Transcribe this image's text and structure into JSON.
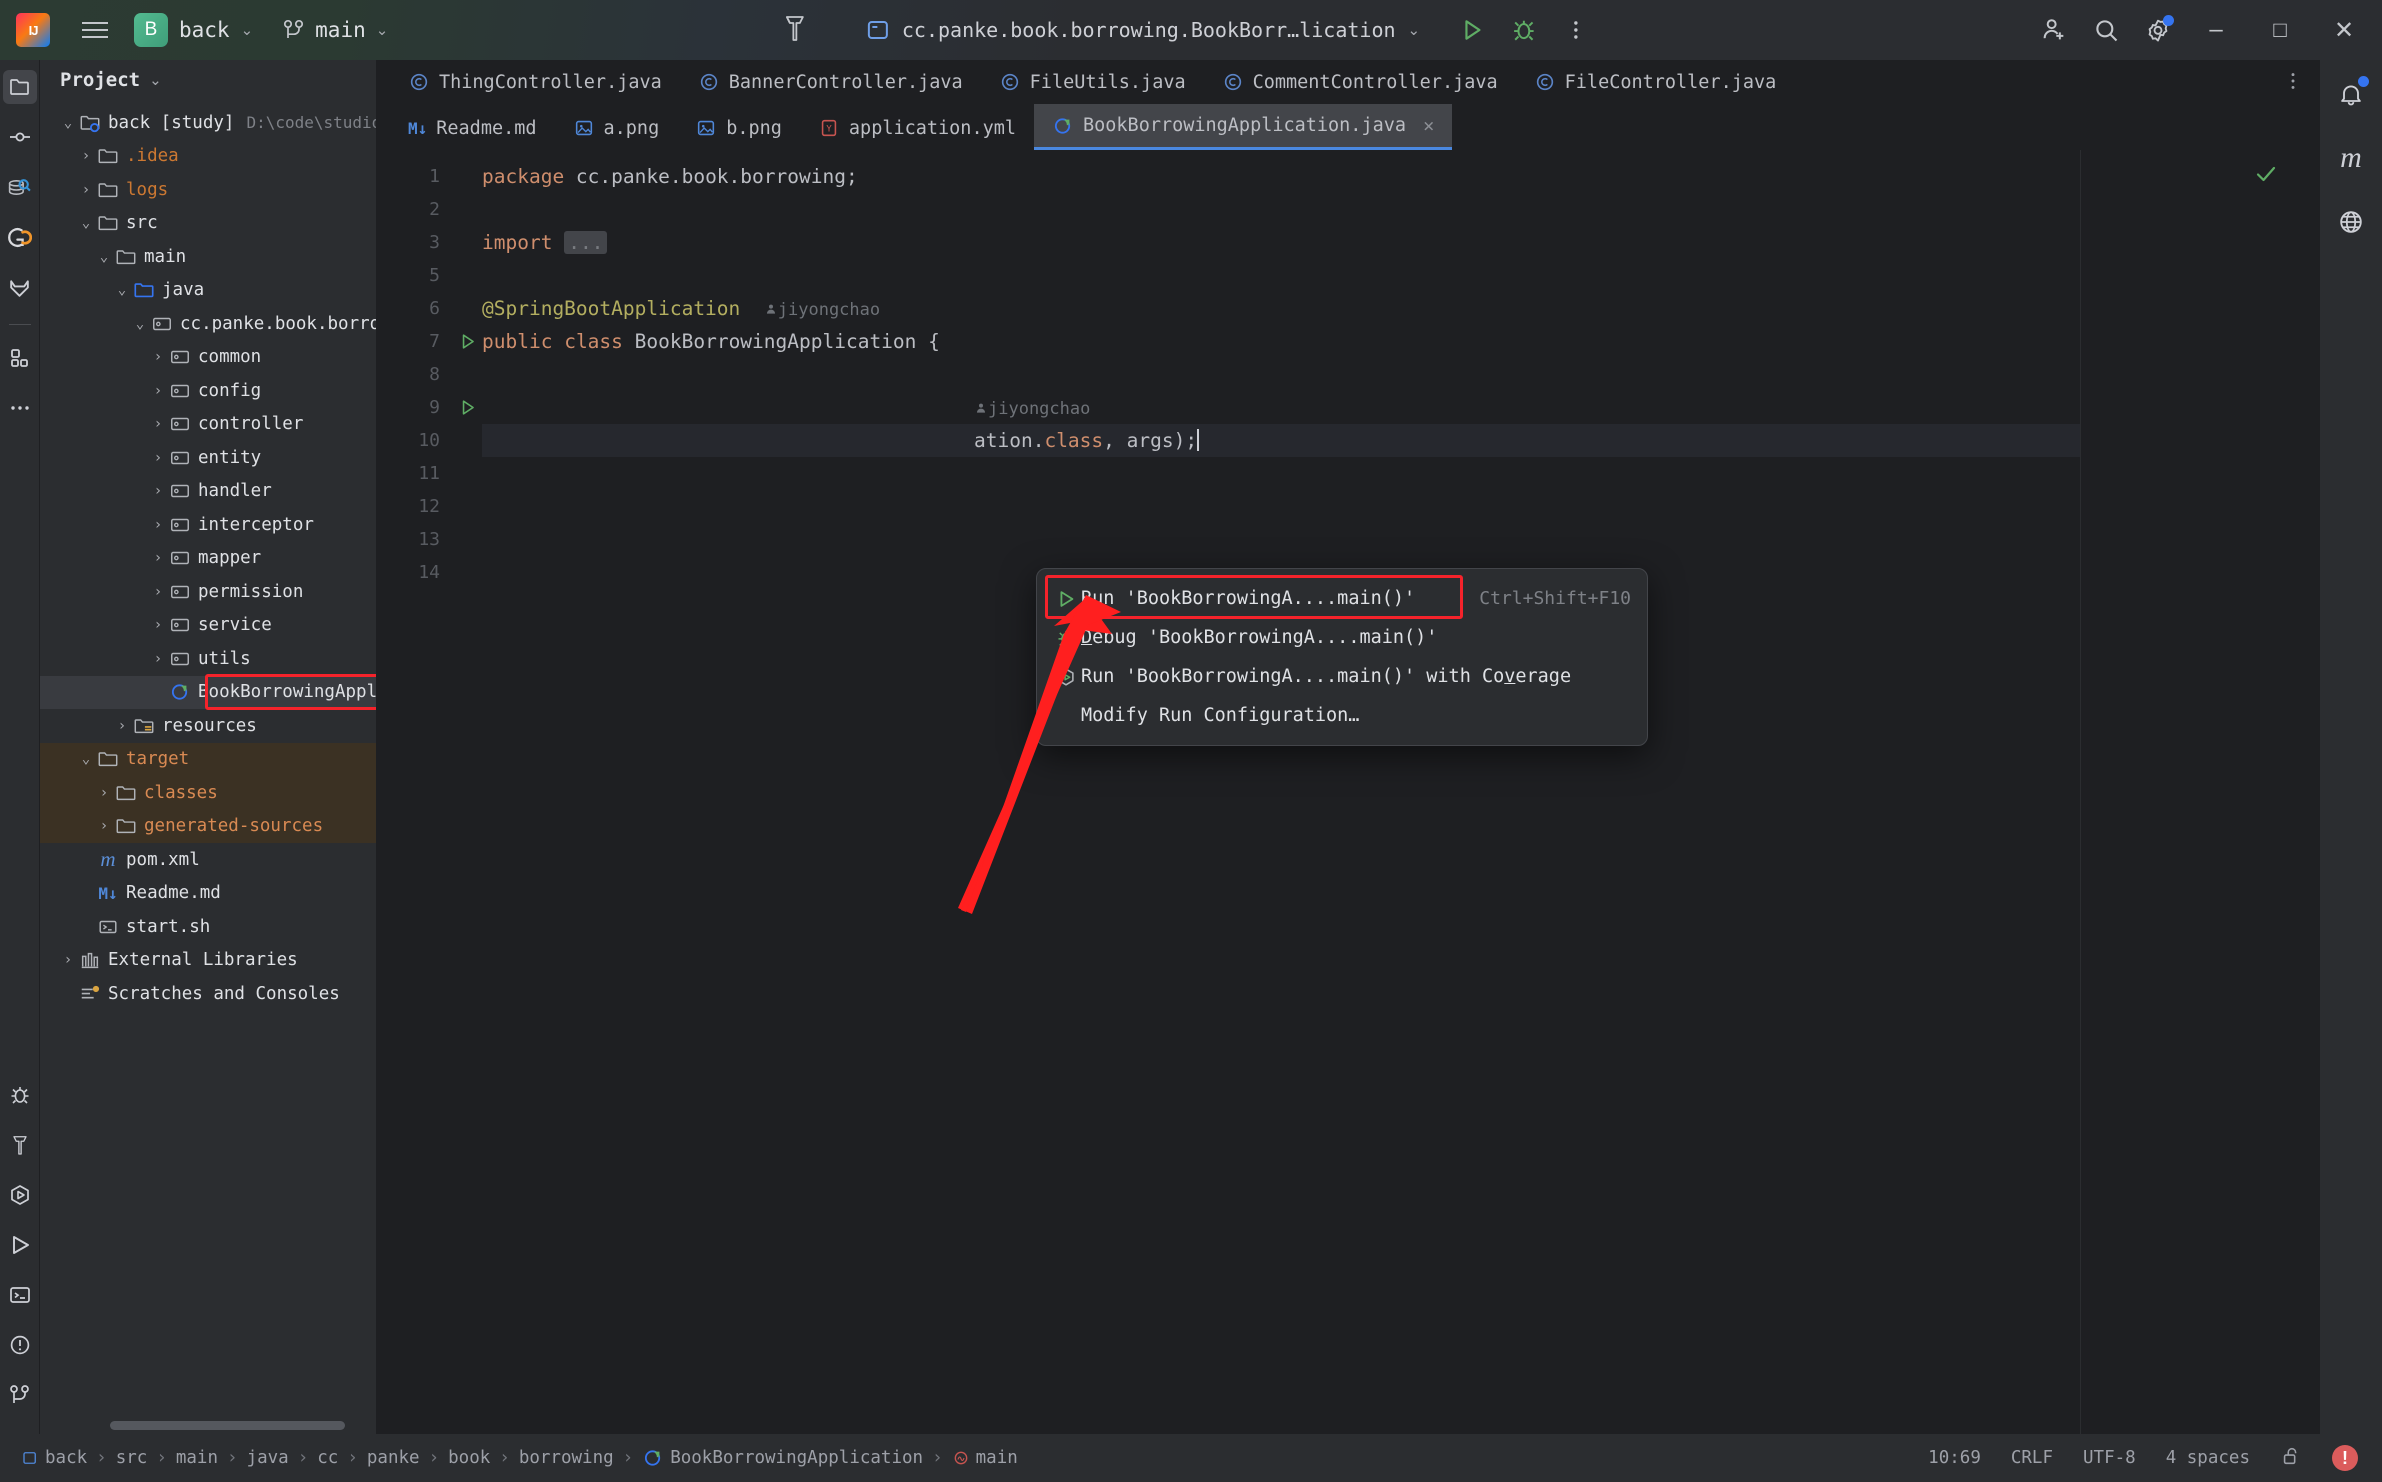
{
  "titlebar": {
    "logo_alt": "IJ",
    "project_badge": "B",
    "project_name": "back",
    "branch_name": "main",
    "run_config": "cc.panke.book.borrowing.BookBorr…lication",
    "run_label": "Run",
    "debug_label": "Debug",
    "more_label": "More",
    "minimize_label": "–",
    "maximize_label": "□",
    "close_label": "✕"
  },
  "project_panel": {
    "title": "Project",
    "tree": [
      {
        "indent": 0,
        "arrow": "⌄",
        "icon": "module-folder-icon",
        "label": "back [study]",
        "sub": "D:\\code\\studio\\book-bor",
        "bold": true
      },
      {
        "indent": 1,
        "arrow": "›",
        "icon": "folder-icon",
        "label": ".idea",
        "orange": true
      },
      {
        "indent": 1,
        "arrow": "›",
        "icon": "folder-icon",
        "label": "logs",
        "orange": true
      },
      {
        "indent": 1,
        "arrow": "⌄",
        "icon": "folder-icon",
        "label": "src"
      },
      {
        "indent": 2,
        "arrow": "⌄",
        "icon": "folder-icon",
        "label": "main"
      },
      {
        "indent": 3,
        "arrow": "⌄",
        "icon": "source-folder-icon",
        "label": "java"
      },
      {
        "indent": 4,
        "arrow": "⌄",
        "icon": "package-icon",
        "label": "cc.panke.book.borrowing"
      },
      {
        "indent": 5,
        "arrow": "›",
        "icon": "package-icon",
        "label": "common"
      },
      {
        "indent": 5,
        "arrow": "›",
        "icon": "package-icon",
        "label": "config"
      },
      {
        "indent": 5,
        "arrow": "›",
        "icon": "package-icon",
        "label": "controller"
      },
      {
        "indent": 5,
        "arrow": "›",
        "icon": "package-icon",
        "label": "entity"
      },
      {
        "indent": 5,
        "arrow": "›",
        "icon": "package-icon",
        "label": "handler"
      },
      {
        "indent": 5,
        "arrow": "›",
        "icon": "package-icon",
        "label": "interceptor"
      },
      {
        "indent": 5,
        "arrow": "›",
        "icon": "package-icon",
        "label": "mapper"
      },
      {
        "indent": 5,
        "arrow": "›",
        "icon": "package-icon",
        "label": "permission"
      },
      {
        "indent": 5,
        "arrow": "›",
        "icon": "package-icon",
        "label": "service"
      },
      {
        "indent": 5,
        "arrow": "›",
        "icon": "package-icon",
        "label": "utils"
      },
      {
        "indent": 5,
        "arrow": "",
        "icon": "spring-class-icon",
        "label": "BookBorrowingApplication",
        "selected": true
      },
      {
        "indent": 3,
        "arrow": "›",
        "icon": "resources-folder-icon",
        "label": "resources"
      },
      {
        "indent": 1,
        "arrow": "⌄",
        "icon": "folder-icon",
        "label": "target",
        "excluded": true
      },
      {
        "indent": 2,
        "arrow": "›",
        "icon": "folder-icon",
        "label": "classes",
        "excluded": true
      },
      {
        "indent": 2,
        "arrow": "›",
        "icon": "folder-icon",
        "label": "generated-sources",
        "excluded": true
      },
      {
        "indent": 1,
        "arrow": "",
        "icon": "maven-icon",
        "label": "pom.xml"
      },
      {
        "indent": 1,
        "arrow": "",
        "icon": "markdown-icon",
        "label": "Readme.md"
      },
      {
        "indent": 1,
        "arrow": "",
        "icon": "shell-icon",
        "label": "start.sh"
      },
      {
        "indent": 0,
        "arrow": "›",
        "icon": "libraries-icon",
        "label": "External Libraries"
      },
      {
        "indent": 0,
        "arrow": "",
        "icon": "scratches-icon",
        "label": "Scratches and Consoles"
      }
    ]
  },
  "editor": {
    "tabs_row1": [
      {
        "icon": "java-class-icon",
        "label": "ThingController.java"
      },
      {
        "icon": "java-class-icon",
        "label": "BannerController.java"
      },
      {
        "icon": "java-class-icon",
        "label": "FileUtils.java"
      },
      {
        "icon": "java-class-icon",
        "label": "CommentController.java"
      },
      {
        "icon": "java-class-icon",
        "label": "FileController.java"
      }
    ],
    "tabs_row2": [
      {
        "icon": "markdown-icon",
        "label": "Readme.md",
        "active": false
      },
      {
        "icon": "image-icon",
        "label": "a.png",
        "active": false
      },
      {
        "icon": "image-icon",
        "label": "b.png",
        "active": false
      },
      {
        "icon": "yaml-icon",
        "label": "application.yml",
        "active": false
      },
      {
        "icon": "spring-class-icon",
        "label": "BookBorrowingApplication.java",
        "active": true,
        "closable": true
      }
    ],
    "line_numbers": [
      "1",
      "2",
      "3",
      "5",
      "6",
      "7",
      "8",
      "9",
      "10",
      "11",
      "12",
      "13",
      "14"
    ],
    "code": {
      "l1_kw": "package",
      "l1_rest": " cc.panke.book.borrowing;",
      "l3_kw": "import",
      "l3_fold": "...",
      "l6_ann": "@SpringBootApplication",
      "l6_author": "jiyongchao",
      "l7_kw1": "public",
      "l7_kw2": "class",
      "l7_name": " BookBorrowingApplication {",
      "l9_author": "jiyongchao",
      "l10_pre": "ation.",
      "l10_kw": "class",
      "l10_post": ", args);"
    }
  },
  "context_menu": {
    "items": [
      {
        "icon": "run-icon",
        "label": "Run 'BookBorrowingA....main()'",
        "mnemonic": "u",
        "shortcut": "Ctrl+Shift+F10",
        "highlighted": true
      },
      {
        "icon": "debug-icon",
        "label": "Debug 'BookBorrowingA....main()'",
        "mnemonic": "D",
        "shortcut": ""
      },
      {
        "icon": "coverage-icon",
        "label": "Run 'BookBorrowingA....main()' with Coverage",
        "mnemonic": "v",
        "shortcut": ""
      },
      {
        "icon": "",
        "label": "Modify Run Configuration…",
        "mnemonic": "",
        "shortcut": ""
      }
    ]
  },
  "status_bar": {
    "breadcrumbs": [
      {
        "icon": "module-icon",
        "label": "back"
      },
      {
        "icon": "",
        "label": "src"
      },
      {
        "icon": "",
        "label": "main"
      },
      {
        "icon": "",
        "label": "java"
      },
      {
        "icon": "",
        "label": "cc"
      },
      {
        "icon": "",
        "label": "panke"
      },
      {
        "icon": "",
        "label": "book"
      },
      {
        "icon": "",
        "label": "borrowing"
      },
      {
        "icon": "spring-class-icon",
        "label": "BookBorrowingApplication"
      },
      {
        "icon": "method-icon",
        "label": "main"
      }
    ],
    "separator": "›",
    "caret_position": "10:69",
    "line_separator": "CRLF",
    "encoding": "UTF-8",
    "indent": "4 spaces",
    "lock_icon": "unlocked-icon",
    "error_badge": "!"
  },
  "colors": {
    "accent_blue": "#3574f0",
    "annotation_red": "#f5232b",
    "green_run": "#59a869",
    "excluded_bg": "#3b3123",
    "panel_bg": "#2b2d30",
    "editor_bg": "#1e1f22"
  }
}
